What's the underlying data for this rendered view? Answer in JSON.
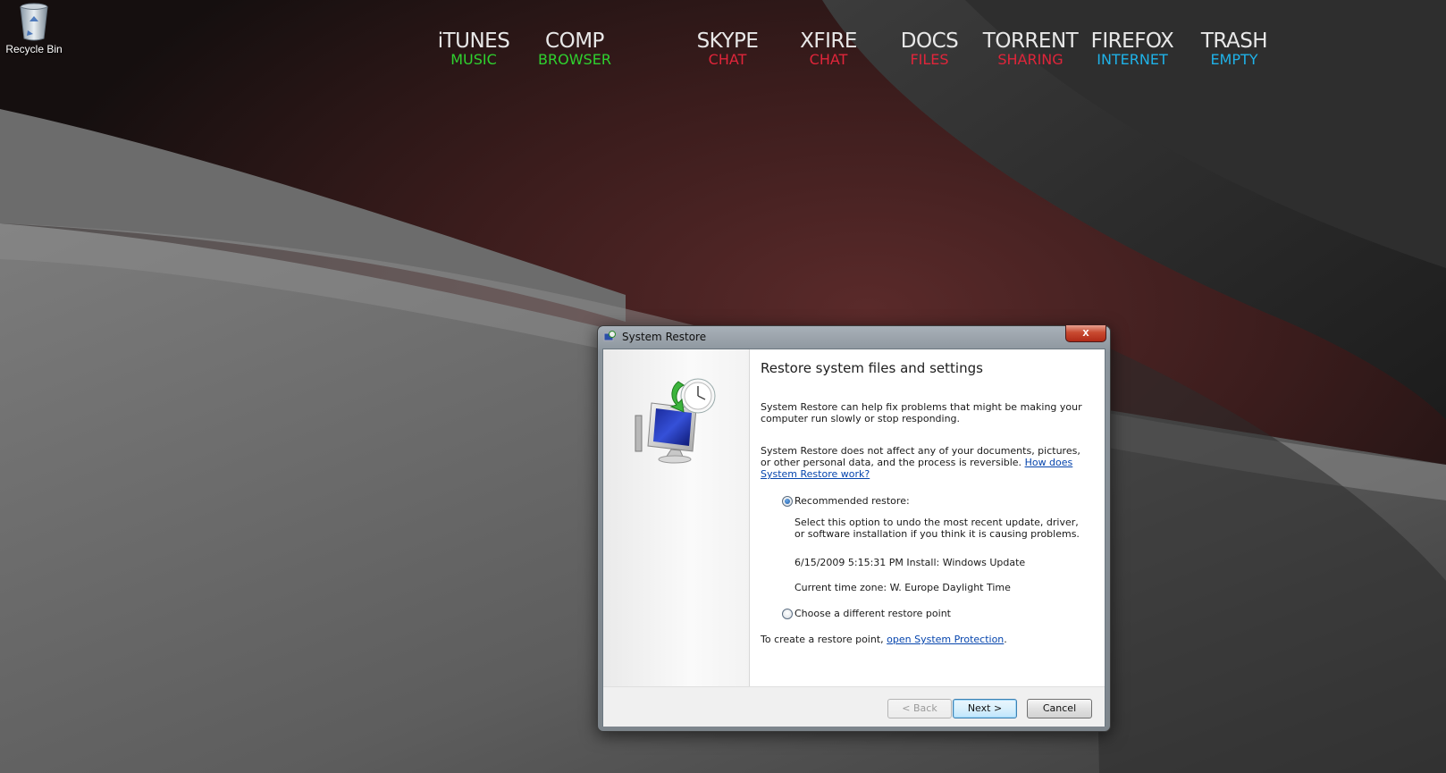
{
  "desktop": {
    "recycle_bin_label": "Recycle Bin",
    "launchers": [
      {
        "title": "iTUNES",
        "subtitle": "MUSIC",
        "color": "#2fd12f"
      },
      {
        "title": "COMP",
        "subtitle": "BROWSER",
        "color": "#2fd12f"
      },
      {
        "title": "SKYPE",
        "subtitle": "CHAT",
        "color": "#e0253a"
      },
      {
        "title": "XFIRE",
        "subtitle": "CHAT",
        "color": "#e0253a"
      },
      {
        "title": "DOCS",
        "subtitle": "FILES",
        "color": "#e0253a"
      },
      {
        "title": "TORRENT",
        "subtitle": "SHARING",
        "color": "#e0253a"
      },
      {
        "title": "FIREFOX",
        "subtitle": "INTERNET",
        "color": "#1fb2e8"
      },
      {
        "title": "TRASH",
        "subtitle": "EMPTY",
        "color": "#1fb2e8"
      }
    ]
  },
  "dialog": {
    "title": "System Restore",
    "close_label": "x",
    "heading": "Restore system files and settings",
    "para1": "System Restore can help fix problems that might be making your computer run slowly or stop responding.",
    "para2_text": "System Restore does not affect any of your documents, pictures, or other personal data, and the process is reversible.",
    "para2_link": "How does System Restore work?",
    "option_recommended": {
      "label": "Recommended restore:",
      "selected": true,
      "description": "Select this option to undo the most recent update, driver, or software installation if you think it is causing problems.",
      "restore_point": "6/15/2009 5:15:31 PM Install: Windows Update",
      "timezone": "Current time zone: W. Europe Daylight Time"
    },
    "option_different": {
      "label": "Choose a different restore point",
      "selected": false
    },
    "protection_text": "To create a restore point,",
    "protection_link": "open System Protection",
    "protection_end": ".",
    "buttons": {
      "back": "< Back",
      "next": "Next >",
      "cancel": "Cancel"
    }
  }
}
